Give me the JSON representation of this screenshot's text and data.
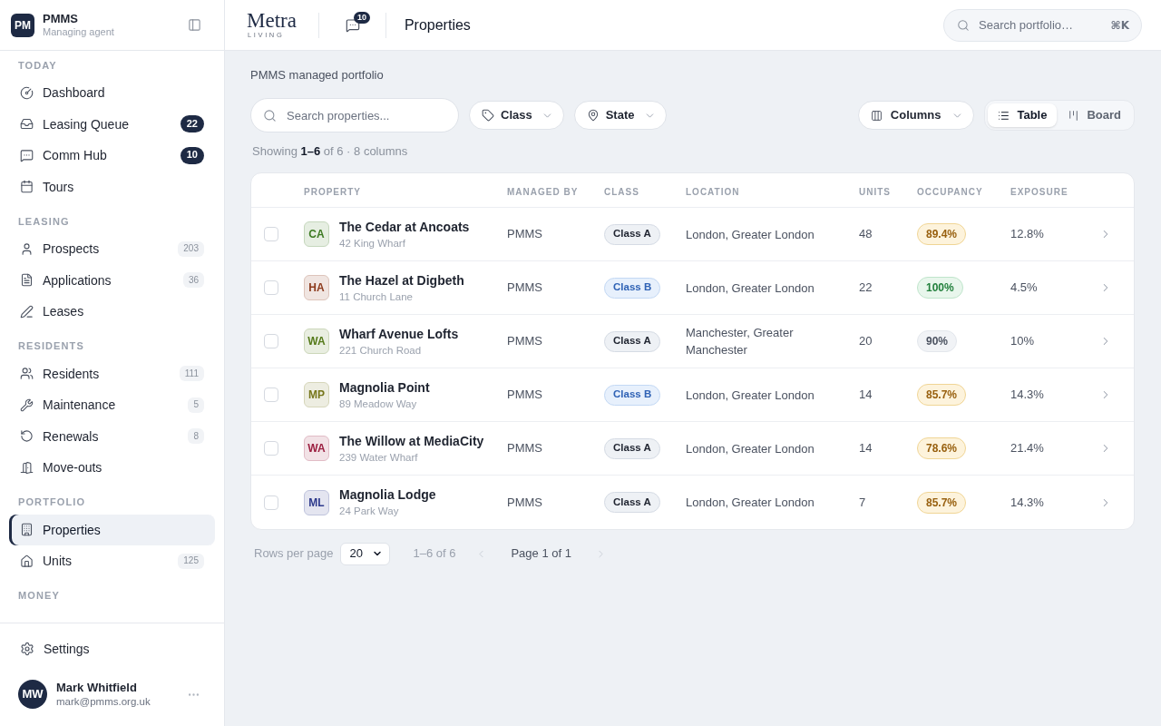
{
  "sidebar": {
    "brand": {
      "initials": "PM",
      "name": "PMMS",
      "subtitle": "Managing agent"
    },
    "sections": [
      {
        "title": "TODAY",
        "items": [
          {
            "label": "Dashboard",
            "selected": false
          },
          {
            "label": "Leasing Queue",
            "selected": false,
            "badge": {
              "text": "22",
              "kind": "strong"
            }
          },
          {
            "label": "Comm Hub",
            "selected": false,
            "badge": {
              "text": "10",
              "kind": "strong"
            }
          },
          {
            "label": "Tours",
            "selected": false
          }
        ]
      },
      {
        "title": "LEASING",
        "items": [
          {
            "label": "Prospects",
            "selected": false,
            "badge": {
              "text": "203",
              "kind": "muted"
            }
          },
          {
            "label": "Applications",
            "selected": false,
            "badge": {
              "text": "36",
              "kind": "muted"
            }
          },
          {
            "label": "Leases",
            "selected": false
          }
        ]
      },
      {
        "title": "RESIDENTS",
        "items": [
          {
            "label": "Residents",
            "selected": false,
            "badge": {
              "text": "111",
              "kind": "muted"
            }
          },
          {
            "label": "Maintenance",
            "selected": false,
            "badge": {
              "text": "5",
              "kind": "muted"
            }
          },
          {
            "label": "Renewals",
            "selected": false,
            "badge": {
              "text": "8",
              "kind": "muted"
            }
          },
          {
            "label": "Move-outs",
            "selected": false
          }
        ]
      },
      {
        "title": "PORTFOLIO",
        "items": [
          {
            "label": "Properties",
            "selected": true
          },
          {
            "label": "Units",
            "selected": false,
            "badge": {
              "text": "125",
              "kind": "muted"
            }
          }
        ]
      },
      {
        "title": "MONEY"
      }
    ],
    "footer": {
      "settings": "Settings",
      "user": {
        "initials": "MW",
        "name": "Mark Whitfield",
        "email": "mark@pmms.org.uk"
      }
    }
  },
  "header": {
    "logo": {
      "name": "Metra",
      "tagline": "LIVING"
    },
    "messages_badge": "10",
    "title": "Properties",
    "search": {
      "placeholder": "Search portfolio…",
      "shortcut": "⌘K"
    }
  },
  "toolbar": {
    "subtitle": "PMMS managed portfolio",
    "search": {
      "placeholder": "Search properties..."
    },
    "filters": [
      "Class",
      "State"
    ],
    "columns_button": "Columns",
    "view_toggle": [
      {
        "label": "Table",
        "selected": true
      },
      {
        "label": "Board",
        "selected": false
      }
    ],
    "summary": "Showing **1–6** of 6 · 8 columns"
  },
  "table": {
    "columns": [
      "PROPERTY",
      "MANAGED BY",
      "CLASS",
      "LOCATION",
      "UNITS",
      "OCCUPANCY",
      "EXPOSURE"
    ],
    "rows": [
      {
        "checked": false,
        "initials": "CA",
        "color": "#3d7a22",
        "name": "The Cedar at Ancoats",
        "address": "42 King Wharf",
        "managed_by": "PMMS",
        "class": {
          "text": "Class A",
          "kind": "neutral"
        },
        "location": "London, Greater London",
        "units": "48",
        "occupancy": {
          "text": "89.4%",
          "kind": "amber"
        },
        "exposure": "12.8%"
      },
      {
        "checked": false,
        "initials": "HA",
        "color": "#8c3a1c",
        "name": "The Hazel at Digbeth",
        "address": "11 Church Lane",
        "managed_by": "PMMS",
        "class": {
          "text": "Class B",
          "kind": "blue"
        },
        "location": "London, Greater London",
        "units": "22",
        "occupancy": {
          "text": "100%",
          "kind": "green"
        },
        "exposure": "4.5%"
      },
      {
        "checked": false,
        "initials": "WA",
        "color": "#557a1a",
        "name": "Wharf Avenue Lofts",
        "address": "221 Church Road",
        "managed_by": "PMMS",
        "class": {
          "text": "Class A",
          "kind": "neutral"
        },
        "location": "Manchester, Greater Manchester",
        "units": "20",
        "occupancy": {
          "text": "90%",
          "kind": "gray"
        },
        "exposure": "10%"
      },
      {
        "checked": false,
        "initials": "MP",
        "color": "#76761a",
        "name": "Magnolia Point",
        "address": "89 Meadow Way",
        "managed_by": "PMMS",
        "class": {
          "text": "Class B",
          "kind": "blue"
        },
        "location": "London, Greater London",
        "units": "14",
        "occupancy": {
          "text": "85.7%",
          "kind": "amber"
        },
        "exposure": "14.3%"
      },
      {
        "checked": false,
        "initials": "WA",
        "color": "#9b1f40",
        "name": "The Willow at MediaCity",
        "address": "239 Water Wharf",
        "managed_by": "PMMS",
        "class": {
          "text": "Class A",
          "kind": "neutral"
        },
        "location": "London, Greater London",
        "units": "14",
        "occupancy": {
          "text": "78.6%",
          "kind": "amber"
        },
        "exposure": "21.4%"
      },
      {
        "checked": false,
        "initials": "ML",
        "color": "#2e3a8c",
        "name": "Magnolia Lodge",
        "address": "24 Park Way",
        "managed_by": "PMMS",
        "class": {
          "text": "Class A",
          "kind": "neutral"
        },
        "location": "London, Greater London",
        "units": "7",
        "occupancy": {
          "text": "85.7%",
          "kind": "amber"
        },
        "exposure": "14.3%"
      }
    ]
  },
  "pager": {
    "label": "Rows per page",
    "page_size": "20",
    "range": "1–6 of 6",
    "page": "Page 1 of 1",
    "prev": {
      "disabled": true
    },
    "next": {
      "disabled": true
    }
  }
}
